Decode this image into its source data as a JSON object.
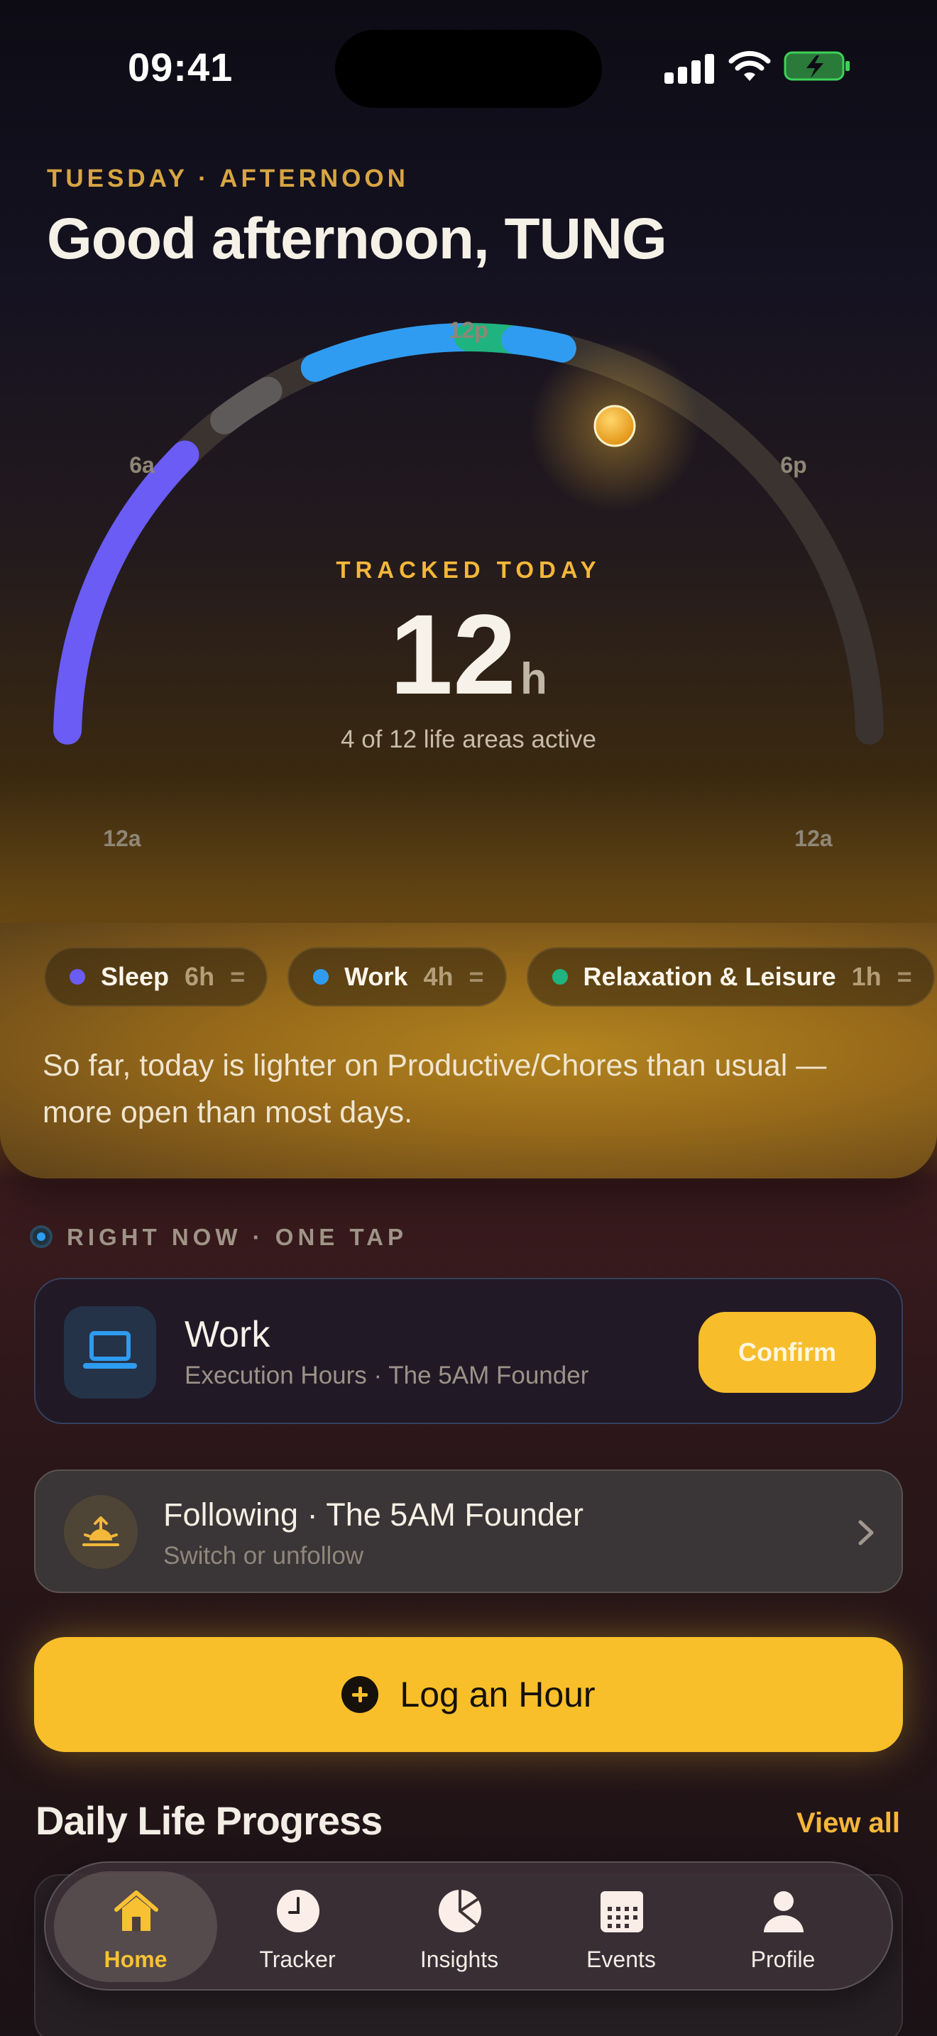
{
  "status_bar": {
    "time": "09:41"
  },
  "header": {
    "day_label": "TUESDAY · AFTERNOON",
    "greeting": "Good afternoon, TUNG"
  },
  "dial": {
    "tick_labels": {
      "top": "12p",
      "upper_left": "6a",
      "upper_right": "6p",
      "bottom_left": "12a",
      "bottom_right": "12a"
    },
    "tracked_label": "TRACKED TODAY",
    "tracked_value": "12",
    "tracked_unit": "h",
    "areas_text": "4 of 12 life areas active",
    "colors": {
      "sleep": "#6a5cf5",
      "work": "#2f9cf2",
      "relax": "#1fb37f",
      "gray": "#5e5a5a",
      "track": "#3a3330",
      "sun": "#f3b739"
    }
  },
  "chips": [
    {
      "name": "Sleep",
      "hours": "6h",
      "eq": "=",
      "color": "#6a5cf5"
    },
    {
      "name": "Work",
      "hours": "4h",
      "eq": "=",
      "color": "#2f9cf2"
    },
    {
      "name": "Relaxation & Leisure",
      "hours": "1h",
      "eq": "=",
      "color": "#1fb37f"
    }
  ],
  "insight_text": "So far, today is lighter on Productive/Chores than usual — more open than most days.",
  "right_now": {
    "label": "RIGHT NOW · ONE TAP",
    "card": {
      "icon": "laptop-icon",
      "title": "Work",
      "subtitle": "Execution Hours · The 5AM Founder",
      "confirm_label": "Confirm"
    }
  },
  "following": {
    "icon": "sunrise-icon",
    "title": "Following · The 5AM Founder",
    "subtitle": "Switch or unfollow"
  },
  "log_button": {
    "label": "Log an Hour",
    "icon": "plus-circle-icon"
  },
  "daily_progress": {
    "title": "Daily Life Progress",
    "view_all": "View all"
  },
  "tabbar": {
    "items": [
      {
        "label": "Home",
        "icon": "home-icon",
        "active": true
      },
      {
        "label": "Tracker",
        "icon": "clock-icon",
        "active": false
      },
      {
        "label": "Insights",
        "icon": "pie-chart-icon",
        "active": false
      },
      {
        "label": "Events",
        "icon": "calendar-icon",
        "active": false
      },
      {
        "label": "Profile",
        "icon": "person-icon",
        "active": false
      }
    ]
  }
}
